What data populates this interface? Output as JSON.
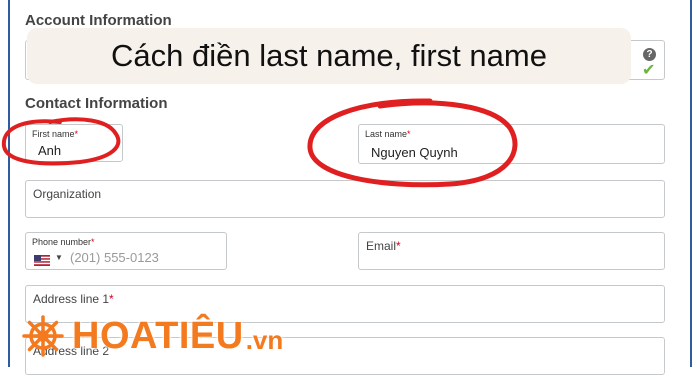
{
  "sections": {
    "account_title": "Account Information",
    "contact_title": "Contact Information"
  },
  "banner": {
    "text": "Cách điền last name, first name"
  },
  "account": {
    "help_icon": "question-icon",
    "status_icon": "check-icon"
  },
  "fields": {
    "first_name": {
      "label": "First name",
      "required": "*",
      "value": "Anh"
    },
    "last_name": {
      "label": "Last name",
      "required": "*",
      "value": "Nguyen Quynh"
    },
    "organization": {
      "label": "Organization"
    },
    "phone": {
      "label": "Phone number",
      "required": "*",
      "placeholder": "(201) 555-0123",
      "country_icon": "us-flag-icon"
    },
    "email": {
      "label": "Email",
      "required": "*"
    },
    "address1": {
      "label": "Address line 1",
      "required": "*"
    },
    "address2": {
      "label": "Address line 2"
    }
  },
  "logo": {
    "name": "HOATIÊU",
    "tld": ".vn"
  },
  "colors": {
    "annotation_red": "#e02020",
    "logo_orange": "#f47a1f",
    "check_green": "#6cb33f",
    "frame_blue": "#2f5c9e"
  }
}
